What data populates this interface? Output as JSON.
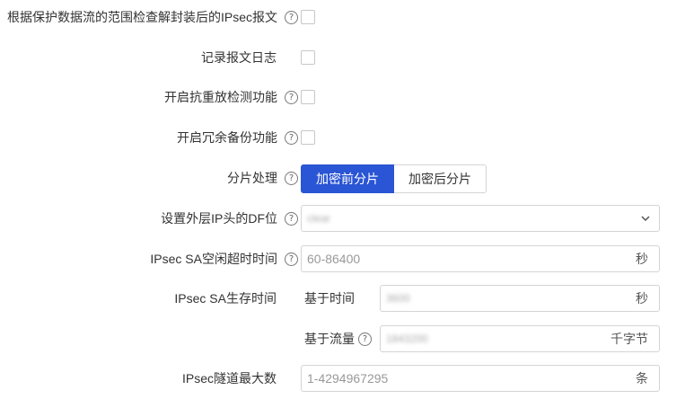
{
  "rows": {
    "check_protect_flow": {
      "label": "根据保护数据流的范围检查解封装后的IPsec报文"
    },
    "log": {
      "label": "记录报文日志"
    },
    "anti_replay": {
      "label": "开启抗重放检测功能"
    },
    "redundancy": {
      "label": "开启冗余备份功能"
    },
    "fragment": {
      "label": "分片处理",
      "options": [
        "加密前分片",
        "加密后分片"
      ],
      "selected": "加密前分片"
    },
    "df_bit": {
      "label": "设置外层IP头的DF位",
      "value": "clear"
    },
    "idle_timeout": {
      "label": "IPsec SA空闲超时时间",
      "placeholder": "60-86400",
      "unit": "秒"
    },
    "lifetime": {
      "label": "IPsec SA生存时间",
      "time_label": "基于时间",
      "time_value": "3600",
      "time_unit": "秒",
      "traffic_label": "基于流量",
      "traffic_value": "1843200",
      "traffic_unit": "千字节"
    },
    "max_tunnels": {
      "label": "IPsec隧道最大数",
      "placeholder": "1-4294967295",
      "unit": "条"
    }
  },
  "help_glyph": "?",
  "colors": {
    "primary": "#2a55d4",
    "border": "#d4d4d4"
  }
}
